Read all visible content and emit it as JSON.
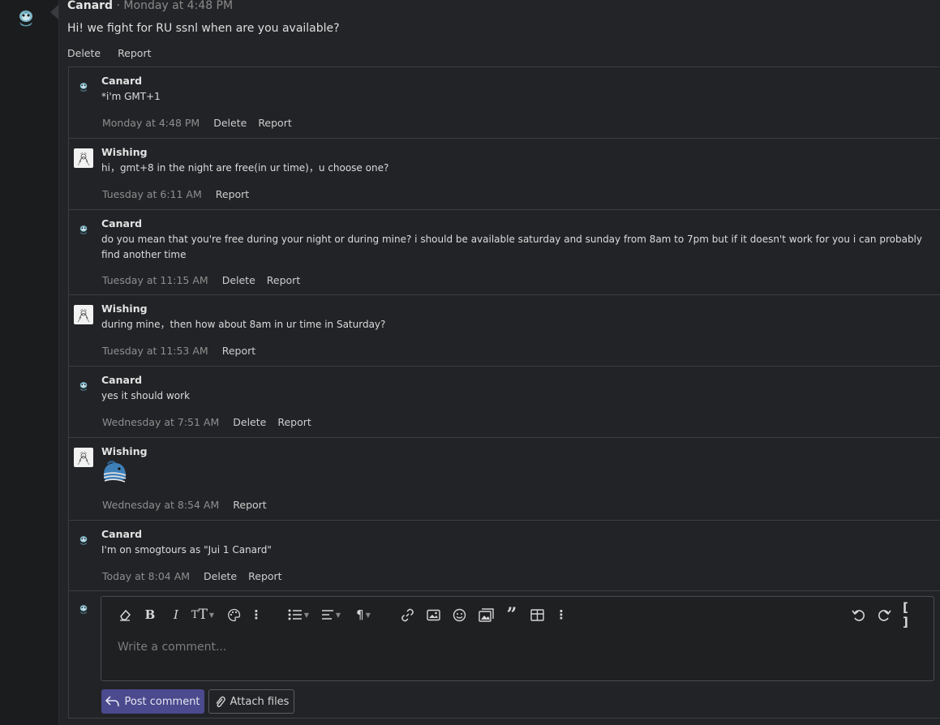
{
  "post": {
    "author": "Canard",
    "separator": " · ",
    "time": "Monday at 4:48 PM",
    "text": "Hi! we fight for RU ssnl when are you available?",
    "actions": [
      "Delete",
      "Report"
    ]
  },
  "comments": [
    {
      "author": "Canard",
      "avatar": "mudkip-avatar",
      "text": "*i'm GMT+1",
      "time": "Monday at 4:48 PM",
      "actions": [
        "Delete",
        "Report"
      ]
    },
    {
      "author": "Wishing",
      "avatar": "sketch-avatar",
      "text": "hi，gmt+8 in the night are free(in ur time)，u choose one?",
      "time": "Tuesday at 6:11 AM",
      "actions": [
        "Report"
      ]
    },
    {
      "author": "Canard",
      "avatar": "mudkip-avatar",
      "text": "do you mean that you're free during your night or during mine? i should be available saturday and sunday from 8am to 7pm but if it doesn't work for you i can probably find another time",
      "time": "Tuesday at 11:15 AM",
      "actions": [
        "Delete",
        "Report"
      ]
    },
    {
      "author": "Wishing",
      "avatar": "sketch-avatar",
      "text": "during mine，then how about 8am in ur time in Saturday?",
      "time": "Tuesday at 11:53 AM",
      "actions": [
        "Report"
      ]
    },
    {
      "author": "Canard",
      "avatar": "mudkip-avatar",
      "text": "yes it should work",
      "time": "Wednesday at 7:51 AM",
      "actions": [
        "Delete",
        "Report"
      ]
    },
    {
      "author": "Wishing",
      "avatar": "sketch-avatar",
      "text": "",
      "time": "Wednesday at 8:54 AM",
      "actions": [
        "Report"
      ],
      "sticker": "wailmer-sticker-icon"
    },
    {
      "author": "Canard",
      "avatar": "mudkip-avatar",
      "text": "I'm on smogtours as \"Jui 1 Canard\"",
      "time": "Today at 8:04 AM",
      "actions": [
        "Delete",
        "Report"
      ]
    }
  ],
  "editor": {
    "placeholder": "Write a comment...",
    "toolbar_icons": [
      "eraser-icon",
      "bold-icon",
      "italic-icon",
      "text-size-icon",
      "palette-icon",
      "more-vertical-icon",
      "list-icon",
      "align-icon",
      "paragraph-icon",
      "link-icon",
      "image-icon",
      "smiley-icon",
      "media-icon",
      "quote-icon",
      "table-icon",
      "more-vertical-icon",
      "undo-icon",
      "redo-icon",
      "bbcode-toggle-icon"
    ],
    "post_label": "Post comment",
    "attach_label": "Attach files"
  },
  "colors": {
    "background": "#1b1c1e",
    "panel": "#232427",
    "accent": "#4b4a8e",
    "border": "#3d3e41",
    "muted": "#8e8e8e"
  }
}
